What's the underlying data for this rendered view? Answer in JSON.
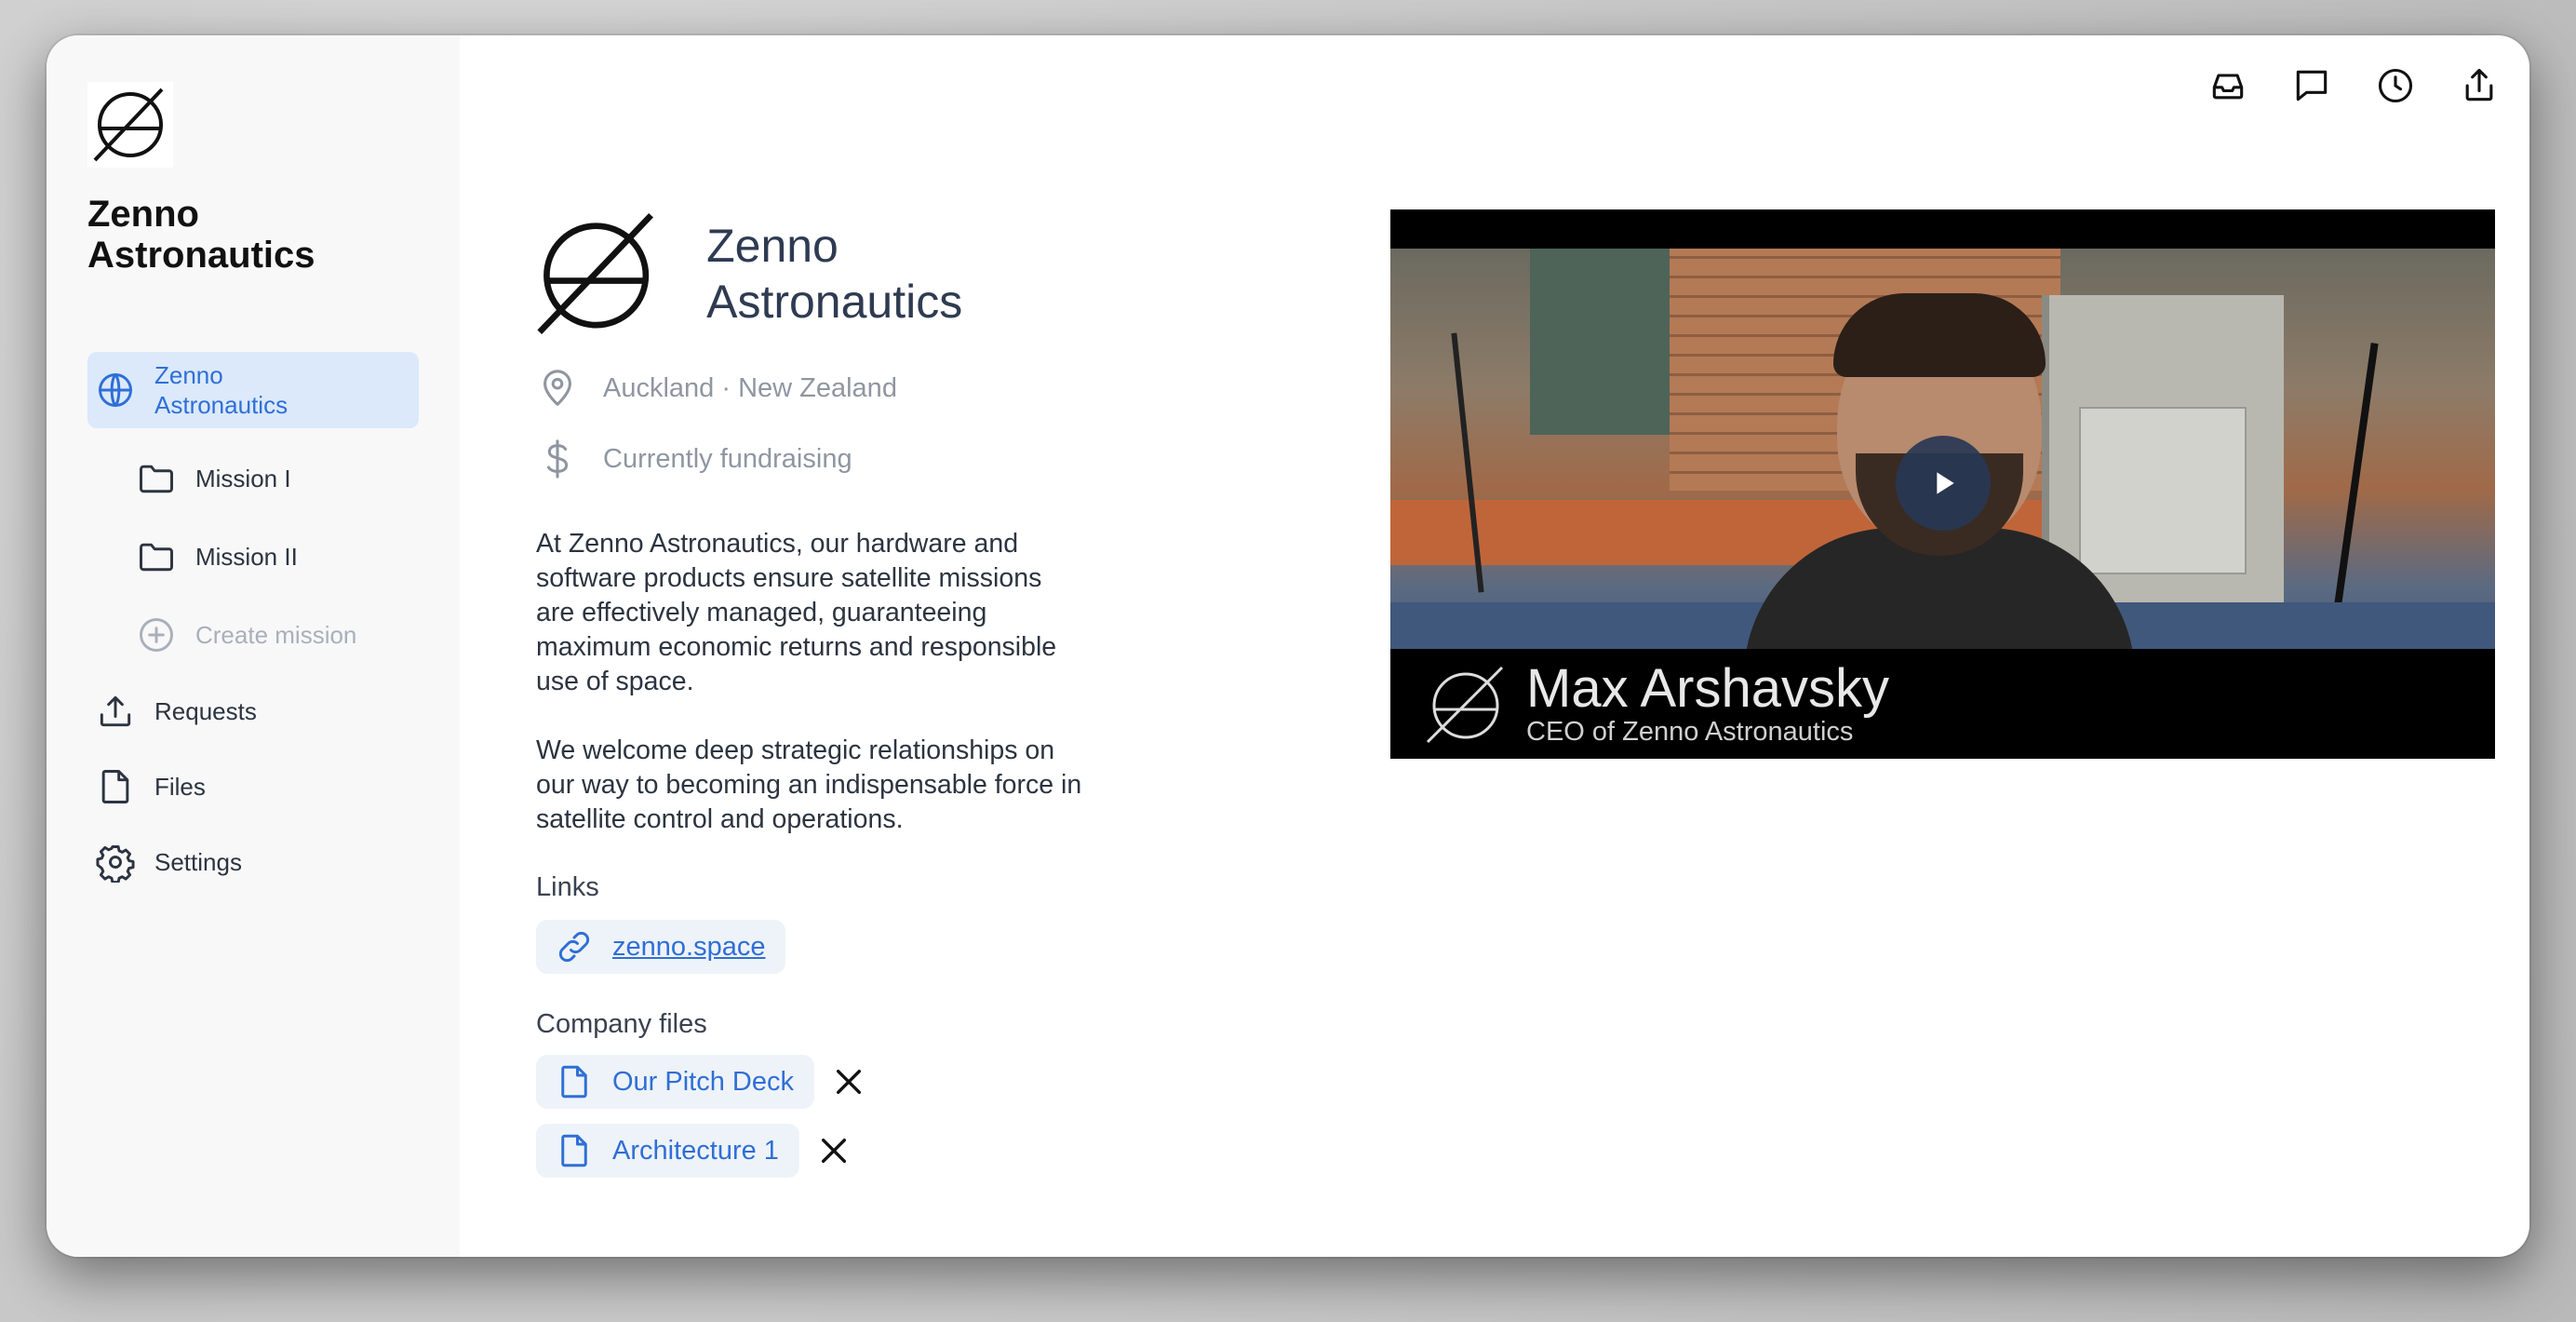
{
  "brand": {
    "name": "Zenno Astronautics"
  },
  "sidebar": {
    "items": [
      {
        "label": "Zenno Astronautics",
        "icon": "globe-icon"
      },
      {
        "label": "Mission I",
        "icon": "folder-icon"
      },
      {
        "label": "Mission II",
        "icon": "folder-icon"
      },
      {
        "label": "Create mission",
        "icon": "plus-circle-icon"
      },
      {
        "label": "Requests",
        "icon": "upload-icon"
      },
      {
        "label": "Files",
        "icon": "file-icon"
      },
      {
        "label": "Settings",
        "icon": "gear-icon"
      }
    ]
  },
  "toolbar": {
    "icons": [
      "inbox-icon",
      "chat-icon",
      "clock-icon",
      "share-icon"
    ]
  },
  "profile": {
    "name": "Zenno Astronautics",
    "location": "Auckland · New Zealand",
    "funding_status": "Currently fundraising",
    "description": [
      "At Zenno Astronautics, our hardware and software products ensure satellite missions are effectively managed, guaranteeing maximum economic returns and responsible use of space.",
      "We welcome deep strategic relationships on our way to becoming an indispensable force in satellite control and operations."
    ],
    "links_title": "Links",
    "link": "zenno.space",
    "files_title": "Company files",
    "files": [
      "Our Pitch Deck",
      "Architecture 1"
    ]
  },
  "video": {
    "speaker_name": "Max Arshavsky",
    "speaker_role": "CEO of Zenno Astronautics"
  },
  "colors": {
    "accent": "#2f6fd6",
    "active_bg": "#dbe9fb",
    "sidebar_bg": "#f8f8f8",
    "play_button": "#283755"
  }
}
